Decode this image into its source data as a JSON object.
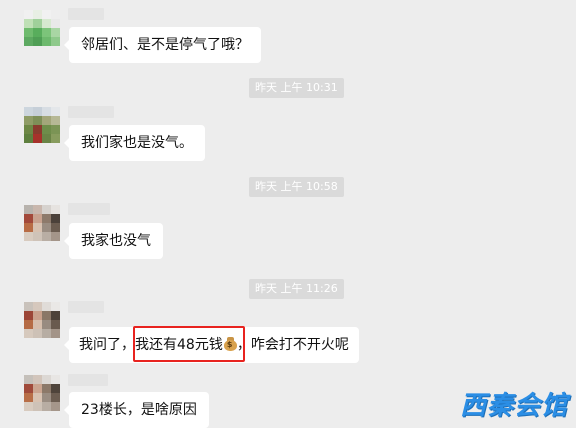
{
  "messages": [
    {
      "text": "邻居们、是不是停气了哦？"
    },
    {
      "text": "我们家也是没气。"
    },
    {
      "text": "我家也没气"
    },
    {
      "text_before": "我问了，",
      "text_highlight": "我还有48元钱",
      "emoji": "money-bag",
      "text_after": "，咋会打不开火呢"
    },
    {
      "text": "23楼长，是啥原因"
    }
  ],
  "timestamps": [
    "昨天 上午 10:31",
    "昨天 上午 10:58",
    "昨天 上午 11:26"
  ],
  "colors": {
    "highlight_border": "#e8231f",
    "watermark": "#2b8ee5",
    "timestamp_bg": "#dadada"
  },
  "watermark": "西秦会馆"
}
